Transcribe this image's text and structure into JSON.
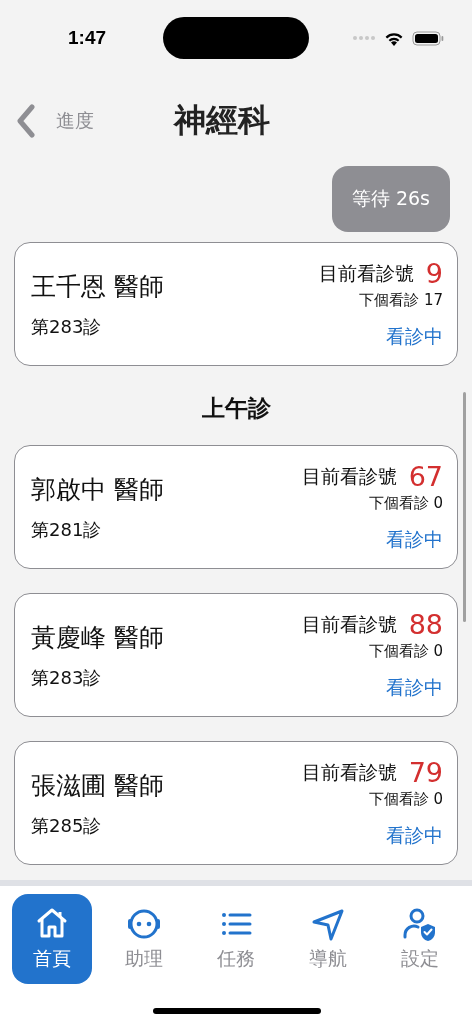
{
  "status_bar": {
    "time": "1:47"
  },
  "nav": {
    "back_label": "進度",
    "title": "神經科"
  },
  "wait_badge": "等待 26s",
  "current": {
    "doctor": "王千恩 醫師",
    "clinic_no": "第283診",
    "now_label": "目前看診號",
    "now_number": "9",
    "next": "下個看診 17",
    "status": "看診中"
  },
  "session": {
    "title": "上午診",
    "doctors": [
      {
        "doctor": "郭啟中 醫師",
        "clinic_no": "第281診",
        "now_label": "目前看診號",
        "now_number": "67",
        "next": "下個看診 0",
        "status": "看診中"
      },
      {
        "doctor": "黃慶峰 醫師",
        "clinic_no": "第283診",
        "now_label": "目前看診號",
        "now_number": "88",
        "next": "下個看診 0",
        "status": "看診中"
      },
      {
        "doctor": "張滋圃 醫師",
        "clinic_no": "第285診",
        "now_label": "目前看診號",
        "now_number": "79",
        "next": "下個看診 0",
        "status": "看診中"
      }
    ]
  },
  "tabs": [
    {
      "kind": "home",
      "label": "首頁",
      "selected": true
    },
    {
      "kind": "assistant",
      "label": "助理",
      "selected": false
    },
    {
      "kind": "tasks",
      "label": "任務",
      "selected": false
    },
    {
      "kind": "navigation",
      "label": "導航",
      "selected": false
    },
    {
      "kind": "settings",
      "label": "設定",
      "selected": false
    }
  ]
}
